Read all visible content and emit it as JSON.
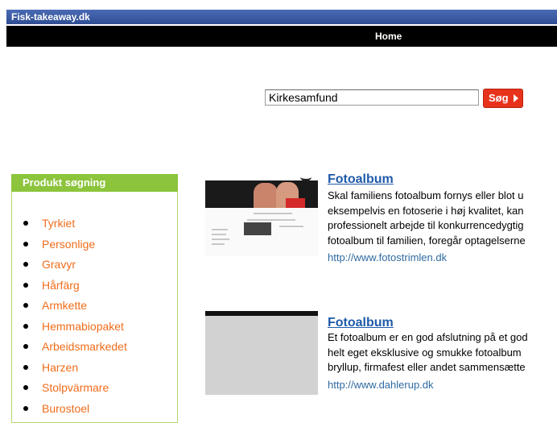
{
  "site": {
    "title": "Fisk-takeaway.dk"
  },
  "nav": {
    "home_label": "Home"
  },
  "search": {
    "value": "Kirkesamfund",
    "button_label": "Søg"
  },
  "sidebar": {
    "title": "Produkt søgning",
    "items": [
      {
        "label": "Tyrkiet"
      },
      {
        "label": "Personlige"
      },
      {
        "label": "Gravyr"
      },
      {
        "label": "Hårfärg"
      },
      {
        "label": "Armkette"
      },
      {
        "label": "Hemmabiopaket"
      },
      {
        "label": "Arbeidsmarkedet"
      },
      {
        "label": "Harzen"
      },
      {
        "label": "Stolpvärmare"
      },
      {
        "label": "Burostoel"
      }
    ]
  },
  "results": [
    {
      "title": "Fotoalbum",
      "lines": [
        "Skal familiens fotoalbum fornys eller blot u",
        "eksempelvis en fotoserie i høj kvalitet, kan",
        "professionelt arbejde til konkurrencedygtig",
        "fotoalbum til familien, foregår optagelserne"
      ],
      "url": "http://www.fotostrimlen.dk"
    },
    {
      "title": "Fotoalbum",
      "lines": [
        "Et fotoalbum er en god afslutning på et god",
        "helt eget eksklusive og smukke fotoalbum",
        "bryllup, firmafest eller andet sammensætte"
      ],
      "url": "http://www.dahlerup.dk"
    }
  ],
  "colors": {
    "site_bar": "#3b5ba3",
    "nav_bar": "#000000",
    "sidebar_header": "#8cc43c",
    "sidebar_link": "#f06c1a",
    "result_title": "#1f5aa8",
    "search_button": "#e8331c"
  },
  "icons": {
    "search_arrow": "arrow-right-icon"
  }
}
